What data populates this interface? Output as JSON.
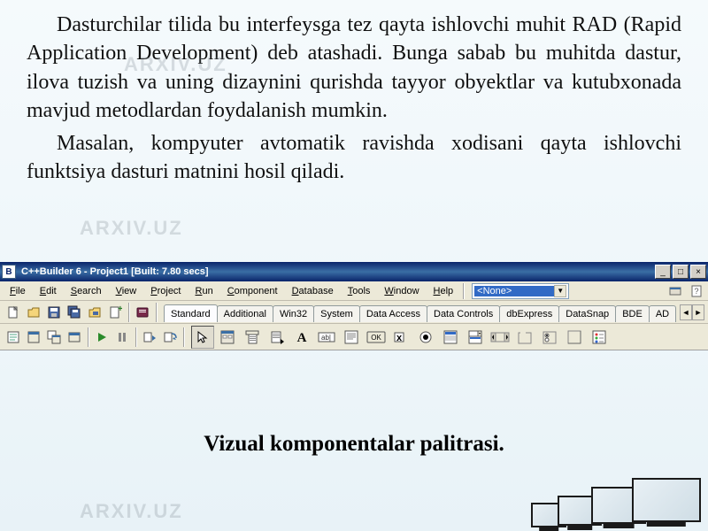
{
  "watermark": "ARXIV.UZ",
  "paragraphs": [
    "Dasturchilar tilida bu interfeysga tez qayta ishlovchi muhit RAD (Rapid Application Development) deb atashadi. Bunga sabab bu muhitda dastur, ilova tuzish va uning dizaynini qurishda tayyor obyektlar va kutubxonada mavjud metodlardan foydalanish mumkin.",
    "Masalan, kompyuter avtomatik ravishda xodisani qayta ishlovchi funktsiya dasturi matnini hosil qiladi."
  ],
  "ide": {
    "title": "C++Builder 6 - Project1 [Built: 7.80 secs]",
    "window_buttons": {
      "min": "_",
      "max": "□",
      "close": "×"
    },
    "menu": [
      "File",
      "Edit",
      "Search",
      "View",
      "Project",
      "Run",
      "Component",
      "Database",
      "Tools",
      "Window",
      "Help"
    ],
    "combo_selected": "<None>",
    "palette_tabs": [
      "Standard",
      "Additional",
      "Win32",
      "System",
      "Data Access",
      "Data Controls",
      "dbExpress",
      "DataSnap",
      "BDE",
      "AD"
    ],
    "active_tab_index": 0
  },
  "caption": "Vizual komponentalar palitrasi."
}
